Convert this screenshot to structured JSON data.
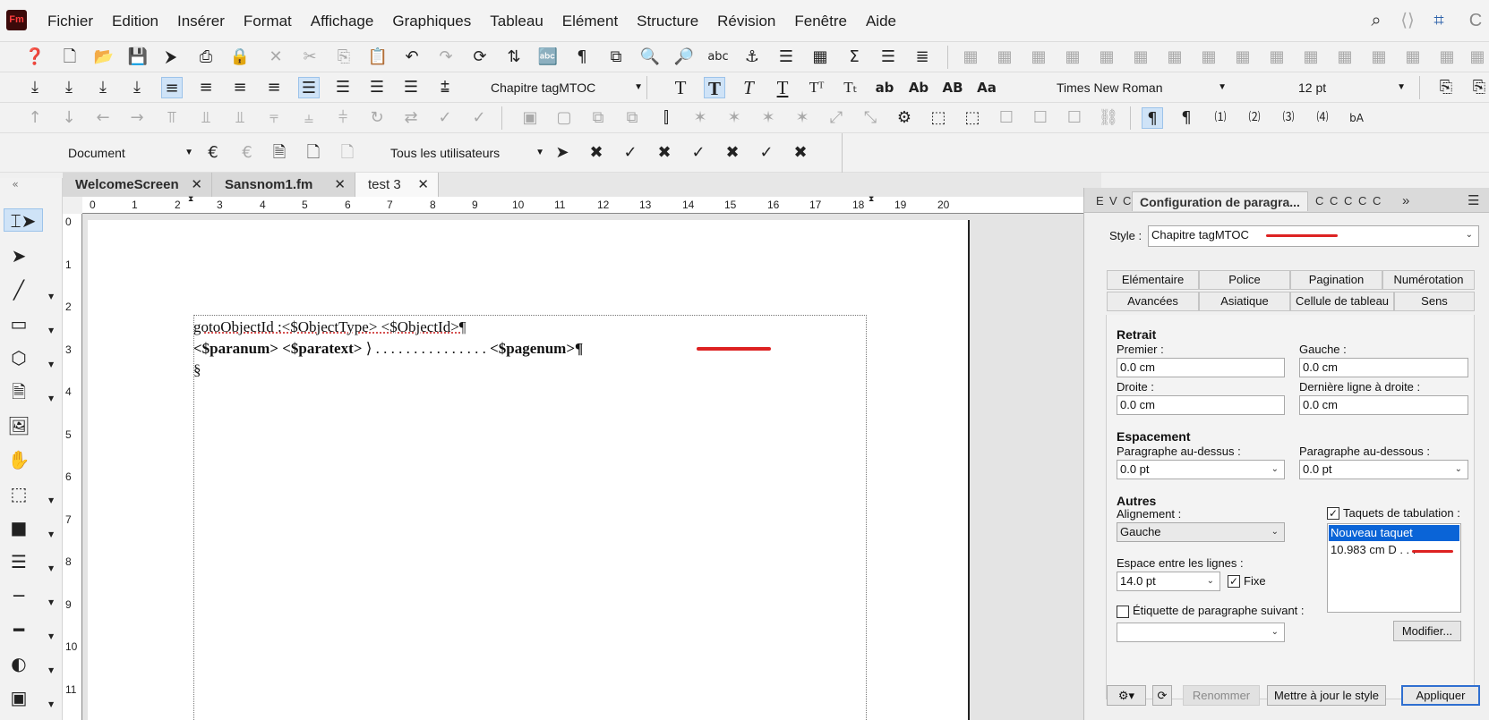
{
  "app": {
    "logo": "Fm"
  },
  "menu": [
    "Fichier",
    "Edition",
    "Insérer",
    "Format",
    "Affichage",
    "Graphiques",
    "Tableau",
    "Elément",
    "Structure",
    "Révision",
    "Fenêtre",
    "Aide"
  ],
  "toolbar2": {
    "paragraph_style": "Chapitre tagMTOC",
    "font": "Times New Roman",
    "size": "12 pt"
  },
  "toolbar4": {
    "view": "Document",
    "users": "Tous les utilisateurs"
  },
  "tabs": [
    "WelcomeScreen",
    "Sansnom1.fm",
    "test 3"
  ],
  "ruler": {
    "h": [
      "0",
      "1",
      "2",
      "3",
      "4",
      "5",
      "6",
      "7",
      "8",
      "9",
      "10",
      "11",
      "12",
      "13",
      "14",
      "15",
      "16",
      "17",
      "18",
      "19",
      "20"
    ],
    "v": [
      "0",
      "1",
      "2",
      "3",
      "4",
      "5",
      "6",
      "7",
      "8",
      "9",
      "10",
      "11"
    ]
  },
  "document": {
    "line1": "gotoObjectId :<$ObjectType> <$ObjectId>¶",
    "line2a": "<$paranum>  <$paratext> ",
    "line2b": "⟩ . . . . . . . . . . . . . . .",
    "line2c": " <$pagenum>¶",
    "line3": "§"
  },
  "panel": {
    "tabs_left": [
      "E",
      "V",
      "C"
    ],
    "title": "Configuration de paragra...",
    "tabs_right": [
      "C",
      "C",
      "C",
      "C",
      "C"
    ],
    "more": "»",
    "style_label": "Style :",
    "style_value": "Chapitre tagMTOC",
    "subtabs": [
      "Elémentaire",
      "Police",
      "Pagination",
      "Numérotation",
      "Avancées",
      "Asiatique",
      "Cellule de tableau",
      "Sens"
    ],
    "retrait": {
      "title": "Retrait",
      "premier_label": "Premier :",
      "premier": "0.0 cm",
      "gauche_label": "Gauche :",
      "gauche": "0.0 cm",
      "droite_label": "Droite :",
      "droite": "0.0 cm",
      "derniere_label": "Dernière ligne à droite :",
      "derniere": "0.0 cm"
    },
    "espacement": {
      "title": "Espacement",
      "dessus_label": "Paragraphe au-dessus :",
      "dessus": "0.0 pt",
      "dessous_label": "Paragraphe au-dessous :",
      "dessous": "0.0 pt"
    },
    "autres": {
      "title": "Autres",
      "alignement_label": "Alignement :",
      "alignement": "Gauche",
      "interligne_label": "Espace entre les lignes :",
      "interligne": "14.0 pt",
      "fixe_label": "Fixe",
      "fixe_checked": true,
      "etiquette_label": "Étiquette de paragraphe suivant :",
      "etiquette_checked": false,
      "etiquette": ""
    },
    "taquets": {
      "label": "Taquets de tabulation :",
      "checked": true,
      "items": [
        "Nouveau taquet",
        "10.983 cm  D  . . ."
      ],
      "modify": "Modifier..."
    },
    "footer": {
      "rename": "Renommer",
      "update": "Mettre à jour le style",
      "apply": "Appliquer"
    }
  }
}
